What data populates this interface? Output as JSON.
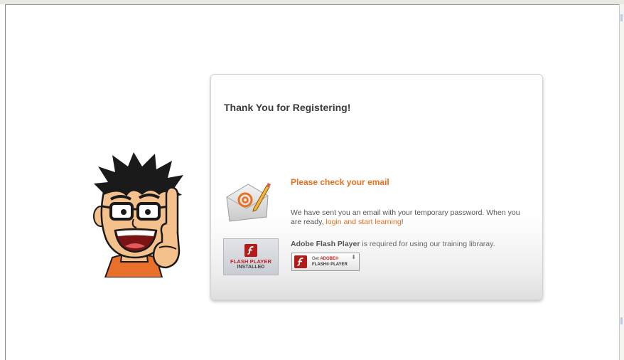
{
  "card": {
    "title": "Thank You for Registering!",
    "subhead": "Please check your email",
    "message_part1": "We have sent you an email with your temporary password. When you are ready, ",
    "message_link": "login and start learning",
    "message_part2": "!"
  },
  "flash": {
    "product_name": "Adobe Flash Player",
    "requirement_text": " is required for using our training libraray.",
    "badge_line1": "FLASH PLAYER",
    "badge_line2": "INSTALLED",
    "button_get": "Get ",
    "button_adobe": "ADOBE®",
    "button_product": "FLASH® PLAYER"
  },
  "colors": {
    "accent": "#e8701f",
    "card_title": "#3a3a3a",
    "flash_red": "#c01f1f"
  },
  "icons": {
    "mascot": "cartoon-man-finger-up",
    "mail": "envelope-with-at-sign-and-pencil",
    "flash_logo": "flash-f-logo",
    "download": "download-arrow"
  }
}
